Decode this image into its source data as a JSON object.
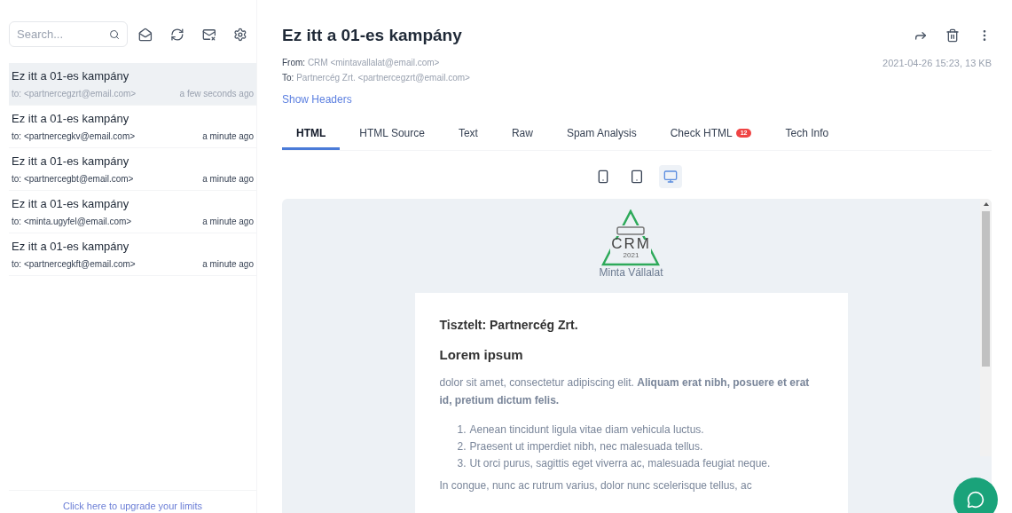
{
  "search": {
    "placeholder": "Search..."
  },
  "messages": [
    {
      "subject": "Ez itt a 01-es kampány",
      "to": "to: <partnercegzrt@email.com>",
      "time": "a few seconds ago",
      "selected": true
    },
    {
      "subject": "Ez itt a 01-es kampány",
      "to": "to: <partnercegkv@email.com>",
      "time": "a minute ago",
      "selected": false
    },
    {
      "subject": "Ez itt a 01-es kampány",
      "to": "to: <partnercegbt@email.com>",
      "time": "a minute ago",
      "selected": false
    },
    {
      "subject": "Ez itt a 01-es kampány",
      "to": "to: <minta.ugyfel@email.com>",
      "time": "a minute ago",
      "selected": false
    },
    {
      "subject": "Ez itt a 01-es kampány",
      "to": "to: <partnercegkft@email.com>",
      "time": "a minute ago",
      "selected": false
    }
  ],
  "upgrade_link": "Click here to upgrade your limits",
  "message": {
    "title": "Ez itt a 01-es kampány",
    "from_label": "From:",
    "from": "CRM <mintavallalat@email.com>",
    "to_label": "To:",
    "to": "Partnercég Zrt. <partnercegzrt@email.com>",
    "meta": "2021-04-26 15:23, 13 KB",
    "show_headers": "Show Headers"
  },
  "tabs": [
    {
      "label": "HTML",
      "selected": true
    },
    {
      "label": "HTML Source",
      "selected": false
    },
    {
      "label": "Text",
      "selected": false
    },
    {
      "label": "Raw",
      "selected": false
    },
    {
      "label": "Spam Analysis",
      "selected": false
    },
    {
      "label": "Check HTML",
      "badge": "12",
      "selected": false
    },
    {
      "label": "Tech Info",
      "selected": false
    }
  ],
  "devices": [
    {
      "kind": "phone",
      "selected": false
    },
    {
      "kind": "tablet",
      "selected": false
    },
    {
      "kind": "desktop",
      "selected": true
    }
  ],
  "email": {
    "logo_text": "CRM",
    "logo_year": "2021",
    "company": "Minta Vállalat",
    "greeting": "Tisztelt: Partnercég Zrt.",
    "heading": "Lorem ipsum",
    "paragraph": "dolor sit amet, consectetur adipiscing elit. **Aliquam erat nibh, posuere et erat id, pretium dictum felis.**",
    "list": [
      "Aenean tincidunt ligula vitae diam vehicula luctus.",
      "Praesent ut imperdiet nibh, nec malesuada tellus.",
      "Ut orci purus, sagittis eget viverra ac, malesuada feugiat neque."
    ],
    "list_numbers": [
      "1.",
      "2.",
      "3."
    ],
    "last_line": "In congue, nunc ac rutrum varius, dolor nunc scelerisque tellus, ac"
  }
}
